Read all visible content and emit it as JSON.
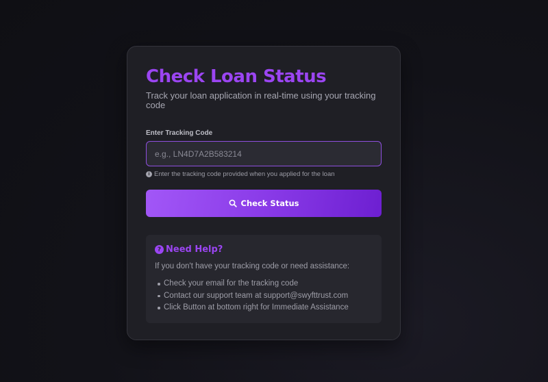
{
  "card": {
    "title": "Check Loan Status",
    "subtitle": "Track your loan application in real-time using your tracking code"
  },
  "form": {
    "label": "Enter Tracking Code",
    "value": "",
    "placeholder": "e.g., LN4D7A2B583214",
    "hint": "Enter the tracking code provided when you applied for the loan",
    "hint_icon": "info-icon",
    "button_label": "Check Status",
    "button_icon": "search-icon"
  },
  "help": {
    "icon": "question-icon",
    "title": "Need Help?",
    "intro": "If you don't have your tracking code or need assistance:",
    "items": [
      "Check your email for the tracking code",
      "Contact our support team at support@swyfttrust.com",
      "Click Button at bottom right for Immediate Assistance"
    ]
  },
  "colors": {
    "accent": "#9b45f2",
    "card_background": "#1f1f25",
    "page_background": "#121218"
  }
}
